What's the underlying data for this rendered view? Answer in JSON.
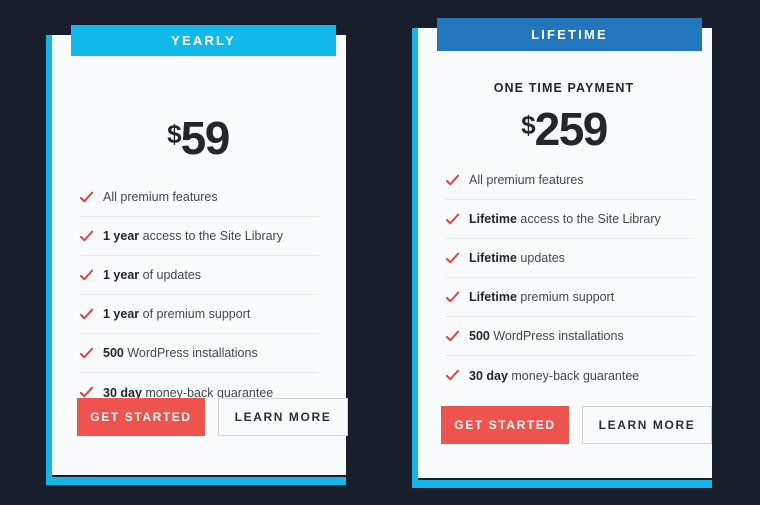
{
  "theme": {
    "page_background": "#191e2d",
    "card_background": "#fafbfc",
    "accent_cyan": "#17b4e9",
    "badge_yearly_color": "#12b9ed",
    "badge_lifetime_color": "#2176bc",
    "primary_button_color": "#ef534d",
    "check_color": "#e0403c",
    "divider_color": "#e9ebee"
  },
  "plans": [
    {
      "id": "yearly",
      "badge_label": "YEARLY",
      "price_note": "",
      "currency": "$",
      "amount": "59",
      "features": [
        {
          "highlight": "",
          "text": "All premium features"
        },
        {
          "highlight": "1 year",
          "text": " access to the Site Library"
        },
        {
          "highlight": "1 year",
          "text": " of updates"
        },
        {
          "highlight": "1 year",
          "text": " of premium support"
        },
        {
          "highlight": "500",
          "text": " WordPress installations"
        },
        {
          "highlight": "30 day",
          "text": " money-back guarantee"
        }
      ],
      "primary_button": "GET STARTED",
      "secondary_button": "LEARN MORE"
    },
    {
      "id": "lifetime",
      "badge_label": "LIFETIME",
      "price_note": "ONE TIME PAYMENT",
      "currency": "$",
      "amount": "259",
      "features": [
        {
          "highlight": "",
          "text": "All premium features"
        },
        {
          "highlight": "Lifetime",
          "text": " access to the Site Library"
        },
        {
          "highlight": "Lifetime",
          "text": " updates"
        },
        {
          "highlight": "Lifetime",
          "text": " premium support"
        },
        {
          "highlight": "500",
          "text": " WordPress installations"
        },
        {
          "highlight": "30 day",
          "text": " money-back guarantee"
        }
      ],
      "primary_button": "GET STARTED",
      "secondary_button": "LEARN MORE"
    }
  ],
  "icons": {
    "check": "check-icon"
  }
}
